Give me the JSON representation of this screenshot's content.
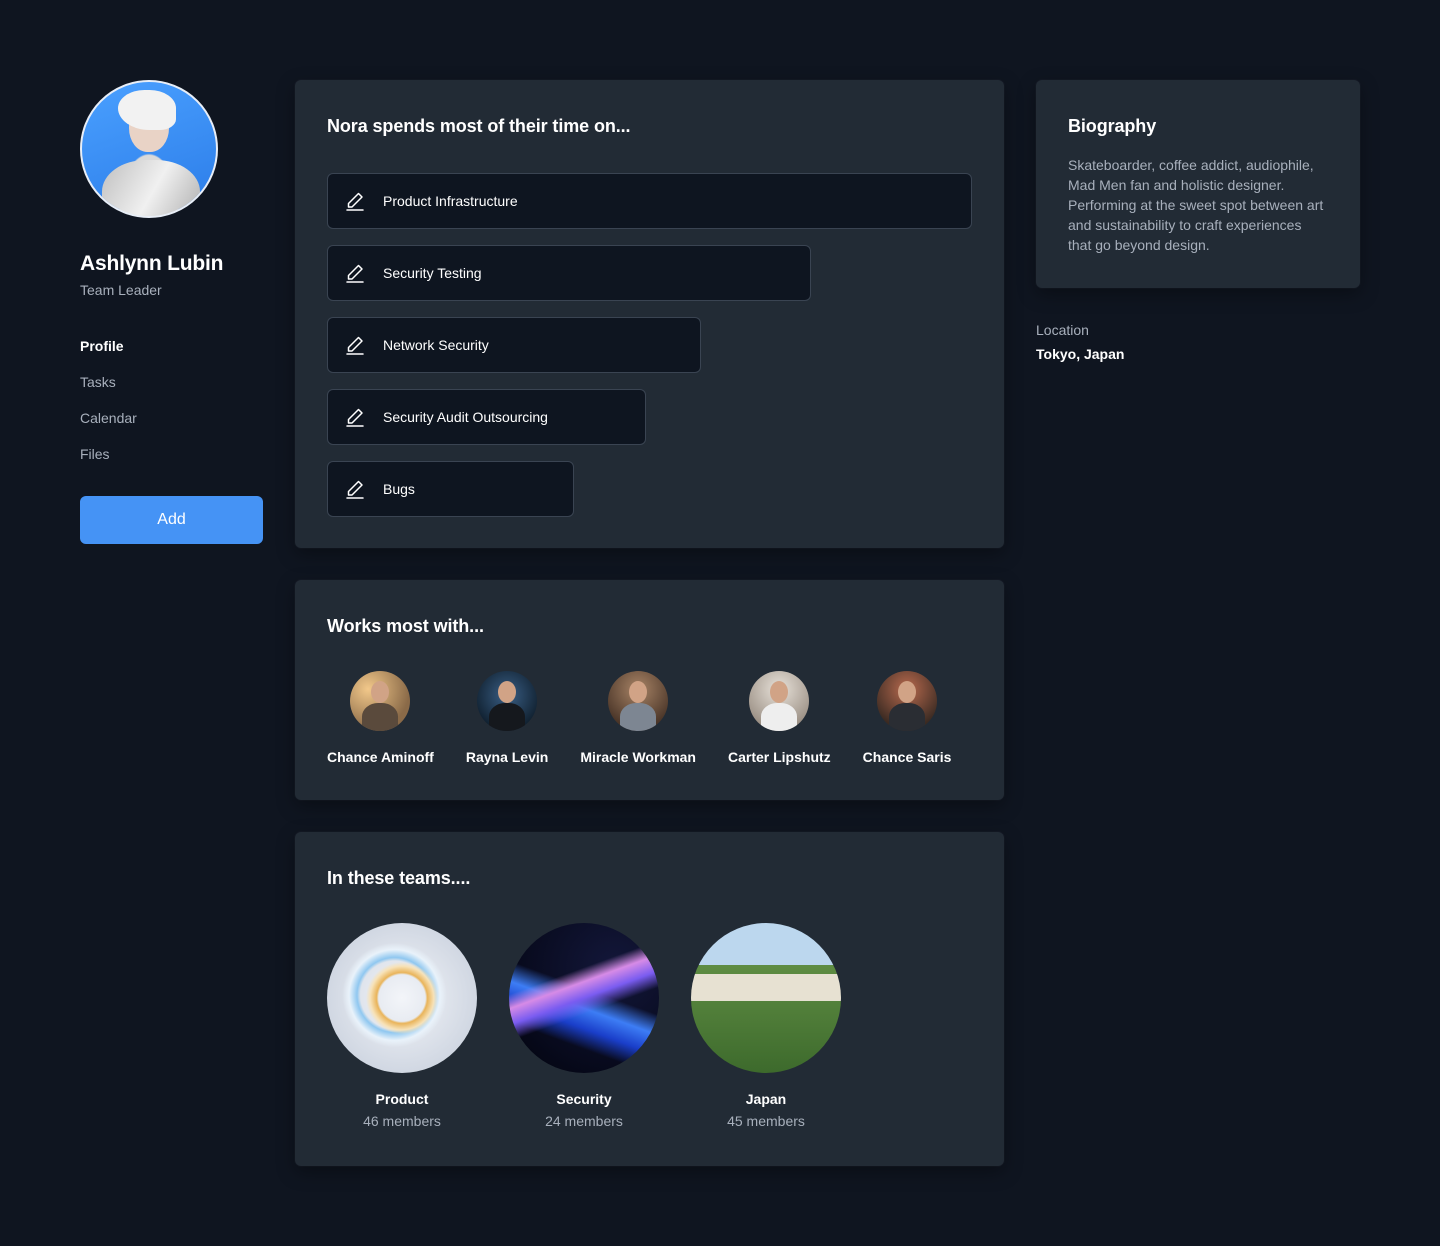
{
  "profile": {
    "name": "Ashlynn Lubin",
    "role": "Team Leader"
  },
  "nav": {
    "items": [
      {
        "label": "Profile",
        "active": true
      },
      {
        "label": "Tasks",
        "active": false
      },
      {
        "label": "Calendar",
        "active": false
      },
      {
        "label": "Files",
        "active": false
      }
    ]
  },
  "add_button": {
    "label": "Add",
    "color": "#4593f5"
  },
  "time_section": {
    "title": "Nora spends most of their time on...",
    "items": [
      {
        "label": "Product Infrastructure",
        "icon": "pencil-icon"
      },
      {
        "label": "Security Testing",
        "icon": "pencil-icon"
      },
      {
        "label": "Network Security",
        "icon": "pencil-icon"
      },
      {
        "label": "Security Audit Outsourcing",
        "icon": "pencil-icon"
      },
      {
        "label": "Bugs",
        "icon": "pencil-icon"
      }
    ]
  },
  "works_section": {
    "title": "Works most with...",
    "people": [
      {
        "name": "Chance Aminoff"
      },
      {
        "name": "Rayna Levin"
      },
      {
        "name": "Miracle Workman"
      },
      {
        "name": "Carter Lipshutz"
      },
      {
        "name": "Chance Saris"
      }
    ]
  },
  "teams_section": {
    "title": "In these teams....",
    "teams": [
      {
        "name": "Product",
        "members": "46 members"
      },
      {
        "name": "Security",
        "members": "24 members"
      },
      {
        "name": "Japan",
        "members": "45 members"
      }
    ]
  },
  "biography": {
    "title": "Biography",
    "text": "Skateboarder, coffee addict, audiophile, Mad Men fan and holistic designer. Performing at the sweet spot between art and sustainability to craft experiences that go beyond design."
  },
  "location": {
    "label": "Location",
    "value": "Tokyo, Japan"
  }
}
